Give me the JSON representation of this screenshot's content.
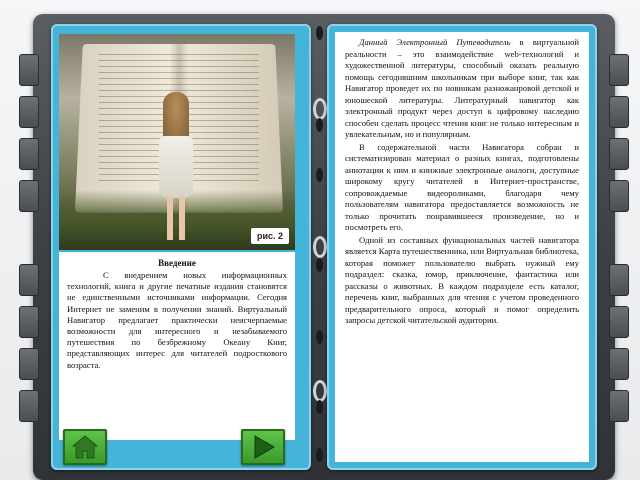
{
  "left_page": {
    "photo_caption": "рис. 2",
    "heading": "Введение",
    "paragraph": "С внедрением новых информационных технологий, книга и другие печатные издания становятся не единственными источниками информации. Сегодня Интернет не заменим в получении знаний. Виртуальный Навигатор предлагает практически неисчерпаемые возможности для интересного и незабываемого путешествия по безбрежному Океану Книг, представляющих интерес для читателей подросткового возраста.",
    "home_icon": "home-icon",
    "next_icon": "play-arrow-icon"
  },
  "right_page": {
    "p1_lead": "Данный Электронный Путеводитель",
    "p1_rest": " в виртуальной реальности – это взаимодействие web-технологий и художественной литературы, способный оказать реальную помощь сегодняшним школьникам при выборе книг, так как Навигатор проведет их по новинкам разножанровой детской и юношеской литературы. Литературный навигатор как электронный продукт через доступ к цифровому наследию способен сделать процесс чтения книг не только интересным и увлекательным, но и популярным.",
    "p2": "В содержательной части Навигатора собран и систематизирован материал о разных книгах, подготовлены аннотации к ним и книжные электронные аналоги, доступные широкому кругу читателей в Интернет-пространстве, сопровождаемые видеороликами, благодаря чему пользователям навигатора предоставляется возможность не только прочитать понравившееся произведение, но и посмотреть его.",
    "p3": "Одной из составных функциональных частей навигатора является Карта путешественника, или Виртуальная библиотека, которая поможет пользователю выбрать нужный ему подраздел: сказка, юмор, приключение, фантастика или рассказы о животных. В каждом подразделе есть каталог, перечень книг, выбранных для чтения с учетом проведенного предварительного опроса, который и помог определить запросы детской читательской аудитории."
  },
  "colors": {
    "page_bg": "#44b4d8",
    "book_frame": "#3d4044",
    "button_green": "#3a9a2b"
  }
}
